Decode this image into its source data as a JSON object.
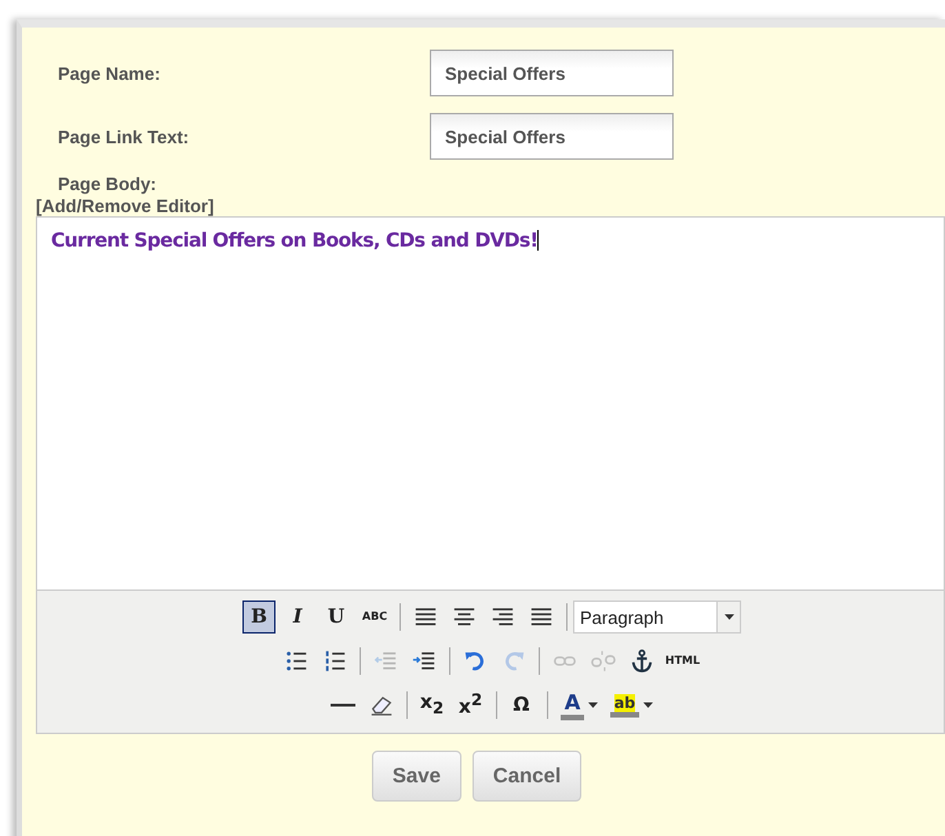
{
  "fields": [
    {
      "label": "Page Name:",
      "value": "Special Offers"
    },
    {
      "label": "Page Link Text:",
      "value": "Special Offers"
    }
  ],
  "body_label": "Page Body:",
  "editor_toggle": "[Add/Remove Editor]",
  "editor": {
    "content": "Current Special Offers on Books, CDs and DVDs!",
    "toolbar": [
      [
        {
          "kind": "text",
          "label": "B",
          "selected": true,
          "disabled": false
        },
        {
          "kind": "text",
          "label": "*I*",
          "selected": false,
          "disabled": false
        },
        {
          "kind": "text",
          "label": "U",
          "selected": false,
          "disabled": false
        },
        {
          "kind": "text",
          "label": "ABC",
          "selected": false,
          "disabled": false
        },
        {
          "kind": "separator"
        },
        {
          "kind": "icon",
          "selected": false,
          "disabled": false
        },
        {
          "kind": "icon",
          "selected": false,
          "disabled": false
        },
        {
          "kind": "icon",
          "selected": false,
          "disabled": false
        },
        {
          "kind": "icon",
          "selected": false,
          "disabled": false
        },
        {
          "kind": "separator"
        },
        {
          "kind": "select",
          "label": "Paragraph"
        }
      ],
      [
        {
          "kind": "icon",
          "selected": false,
          "disabled": false
        },
        {
          "kind": "icon",
          "selected": false,
          "disabled": false
        },
        {
          "kind": "separator"
        },
        {
          "kind": "icon",
          "selected": false,
          "disabled": true
        },
        {
          "kind": "icon",
          "selected": false,
          "disabled": false
        },
        {
          "kind": "separator"
        },
        {
          "kind": "icon",
          "selected": false,
          "disabled": false
        },
        {
          "kind": "icon",
          "selected": false,
          "disabled": true
        },
        {
          "kind": "separator"
        },
        {
          "kind": "icon",
          "selected": false,
          "disabled": true
        },
        {
          "kind": "icon",
          "selected": false,
          "disabled": true
        },
        {
          "kind": "icon",
          "selected": false,
          "disabled": false
        },
        {
          "kind": "text",
          "label": "HTML",
          "selected": false,
          "disabled": false
        }
      ],
      [
        {
          "kind": "icon",
          "selected": false,
          "disabled": false
        },
        {
          "kind": "icon",
          "selected": false,
          "disabled": false
        },
        {
          "kind": "separator"
        },
        {
          "kind": "text",
          "label": "x$_{2}$",
          "selected": false,
          "disabled": false
        },
        {
          "kind": "text",
          "label": "x$^{2}$",
          "selected": false,
          "disabled": false
        },
        {
          "kind": "separator"
        },
        {
          "kind": "text",
          "label": "Ω",
          "selected": false,
          "disabled": false
        },
        {
          "kind": "separator"
        },
        {
          "kind": "split",
          "label": "A",
          "selected": false,
          "disabled": false
        },
        {
          "kind": "split",
          "label": "ab",
          "selected": false,
          "disabled": false
        }
      ]
    ]
  },
  "buttons": [
    "Save",
    "Cancel"
  ]
}
